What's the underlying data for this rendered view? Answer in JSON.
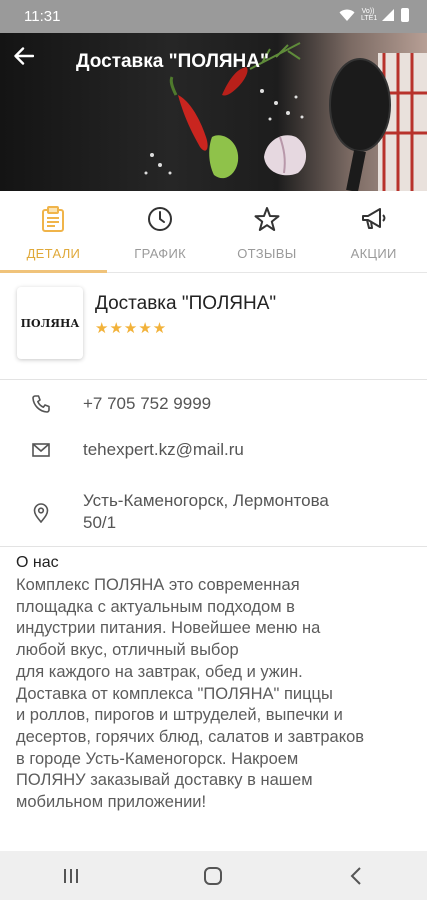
{
  "status_bar": {
    "time": "11:31",
    "network": "Vo)) LTE1"
  },
  "header": {
    "title": "Доставка \"ПОЛЯНА\"",
    "back_icon": "arrow-back-icon"
  },
  "tabs": [
    {
      "label": "ДЕТАЛИ",
      "icon": "clipboard-icon",
      "active": true
    },
    {
      "label": "ГРАФИК",
      "icon": "clock-icon",
      "active": false
    },
    {
      "label": "ОТЗЫВЫ",
      "icon": "star-icon",
      "active": false
    },
    {
      "label": "АКЦИИ",
      "icon": "megaphone-icon",
      "active": false
    }
  ],
  "organization": {
    "name": "Доставка \"ПОЛЯНА\"",
    "logo_text": "ПОЛЯНА",
    "rating": 5,
    "rating_stars": "★★★★★"
  },
  "contacts": {
    "phone": "+7 705 752 9999",
    "email": "tehexpert.kz@mail.ru",
    "address": "Усть-Каменогорск, Лермонтова\n50/1"
  },
  "about": {
    "title": "О нас",
    "text": "Комплекс ПОЛЯНА это современная\nплощадка с актуальным подходом в\nиндустрии питания. Новейшее меню на\nлюбой вкус, отличный выбор\nдля каждого на завтрак, обед и ужин.\nДоставка от комплекса \"ПОЛЯНА\" пиццы\nи роллов, пирогов и штруделей, выпечки и\nдесертов, горячих блюд, салатов и завтраков\nв городе Усть-Каменогорск. Накроем\nПОЛЯНУ заказывай доставку в нашем\nмобильном приложении!"
  },
  "colors": {
    "accent": "#f0c37a",
    "accent_text": "#e0a93a",
    "stars": "#f2b23a",
    "status_bar": "#9a9a9a",
    "nav_bar": "#efefef"
  }
}
